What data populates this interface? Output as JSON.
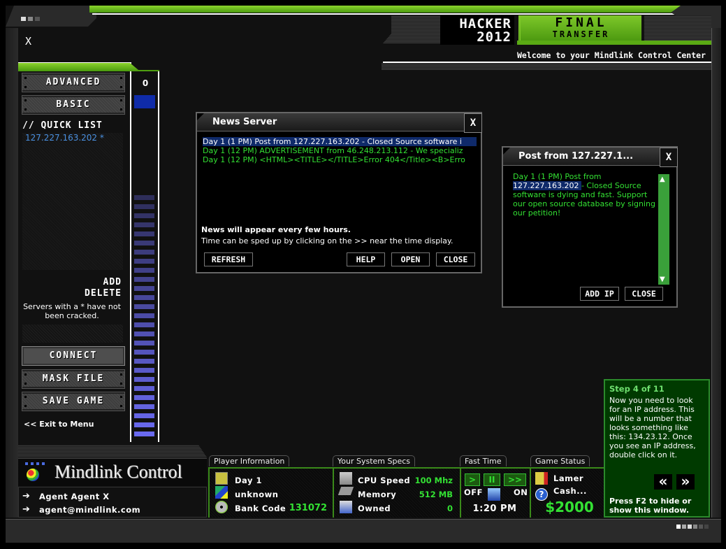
{
  "app": {
    "title_line1": "HACKER",
    "title_line2": "2012",
    "subtitle_line1": "FINAL",
    "subtitle_line2": "TRANSFER",
    "welcome": "Welcome to your Mindlink Control Center",
    "close_label": "X"
  },
  "sidebar": {
    "buttons": {
      "advanced": "ADVANCED",
      "basic": "BASIC",
      "connect": "CONNECT",
      "mask_file": "MASK FILE",
      "save_game": "SAVE GAME"
    },
    "quick_list_title": "// QUICK LIST",
    "quick_list_items": [
      "127.227.163.202 *"
    ],
    "add_label": "ADD",
    "delete_label": "DELETE",
    "note": "Servers with a * have not been cracked.",
    "exit_label": "<< Exit to Menu"
  },
  "meter": {
    "value": "0",
    "segments": 27,
    "color_low": "#2e2e5a",
    "color_high": "#6a6af0"
  },
  "news_window": {
    "title": "News Server",
    "close_label": "X",
    "items": [
      {
        "text": "Day 1 (1 PM) Post from 127.227.163.202 - Closed Source software i",
        "selected": true
      },
      {
        "text": "Day 1 (12 PM) ADVERTISEMENT from 46.248.213.112 - We specializ",
        "selected": false
      },
      {
        "text": "Day 1 (12 PM) <HTML><TITLE></TITLE>Error 404</Title><B>Erro",
        "selected": false
      }
    ],
    "info_bold": "News will appear every few hours.",
    "info": "Time can be sped up by clicking on the >> near the time display.",
    "buttons": {
      "refresh": "REFRESH",
      "help": "HELP",
      "open": "OPEN",
      "close": "CLOSE"
    }
  },
  "post_window": {
    "title": "Post from 127.227.1...",
    "close_label": "X",
    "text_before": "Day 1 (1 PM) Post from ",
    "highlighted_ip": "127.227.163.202 ",
    "text_after": "- Closed Source software is dying and fast. Support our open source database by signing our petition!",
    "buttons": {
      "add_ip": "ADD IP",
      "close": "CLOSE"
    }
  },
  "tutorial": {
    "step": "Step 4 of 11",
    "body": "Now you need to look for an IP address. This will be a number that looks something like this: 134.23.12. Once you see an IP address, double click on it.",
    "prev_label": "«",
    "next_label": "»",
    "footer": "Press F2 to hide or show this window."
  },
  "mindlink": {
    "title": "Mindlink Control",
    "agent_name": "Agent Agent X",
    "agent_email": "agent@mindlink.com"
  },
  "player_info": {
    "tab": "Player Information",
    "day": "Day 1",
    "status": "unknown",
    "bank_label": "Bank Code",
    "bank_code": "131072"
  },
  "system_specs": {
    "tab": "Your System Specs",
    "cpu_label": "CPU Speed",
    "cpu_value": "100 Mhz",
    "memory_label": "Memory",
    "memory_value": "512 MB",
    "owned_label": "Owned",
    "owned_value": "0"
  },
  "fast_time": {
    "tab": "Fast Time",
    "play": ">",
    "pause": "II",
    "fast": ">>",
    "off_label": "OFF",
    "on_label": "ON",
    "time": "1:20 PM"
  },
  "game_status": {
    "tab": "Game Status",
    "rank": "Lamer",
    "cash_label": "Cash...",
    "cash": "$2000"
  },
  "colors": {
    "accent_green": "#5aaa14",
    "text_green": "#33e033",
    "link_blue": "#4a90e0",
    "selection_blue": "#0f2a6a"
  }
}
